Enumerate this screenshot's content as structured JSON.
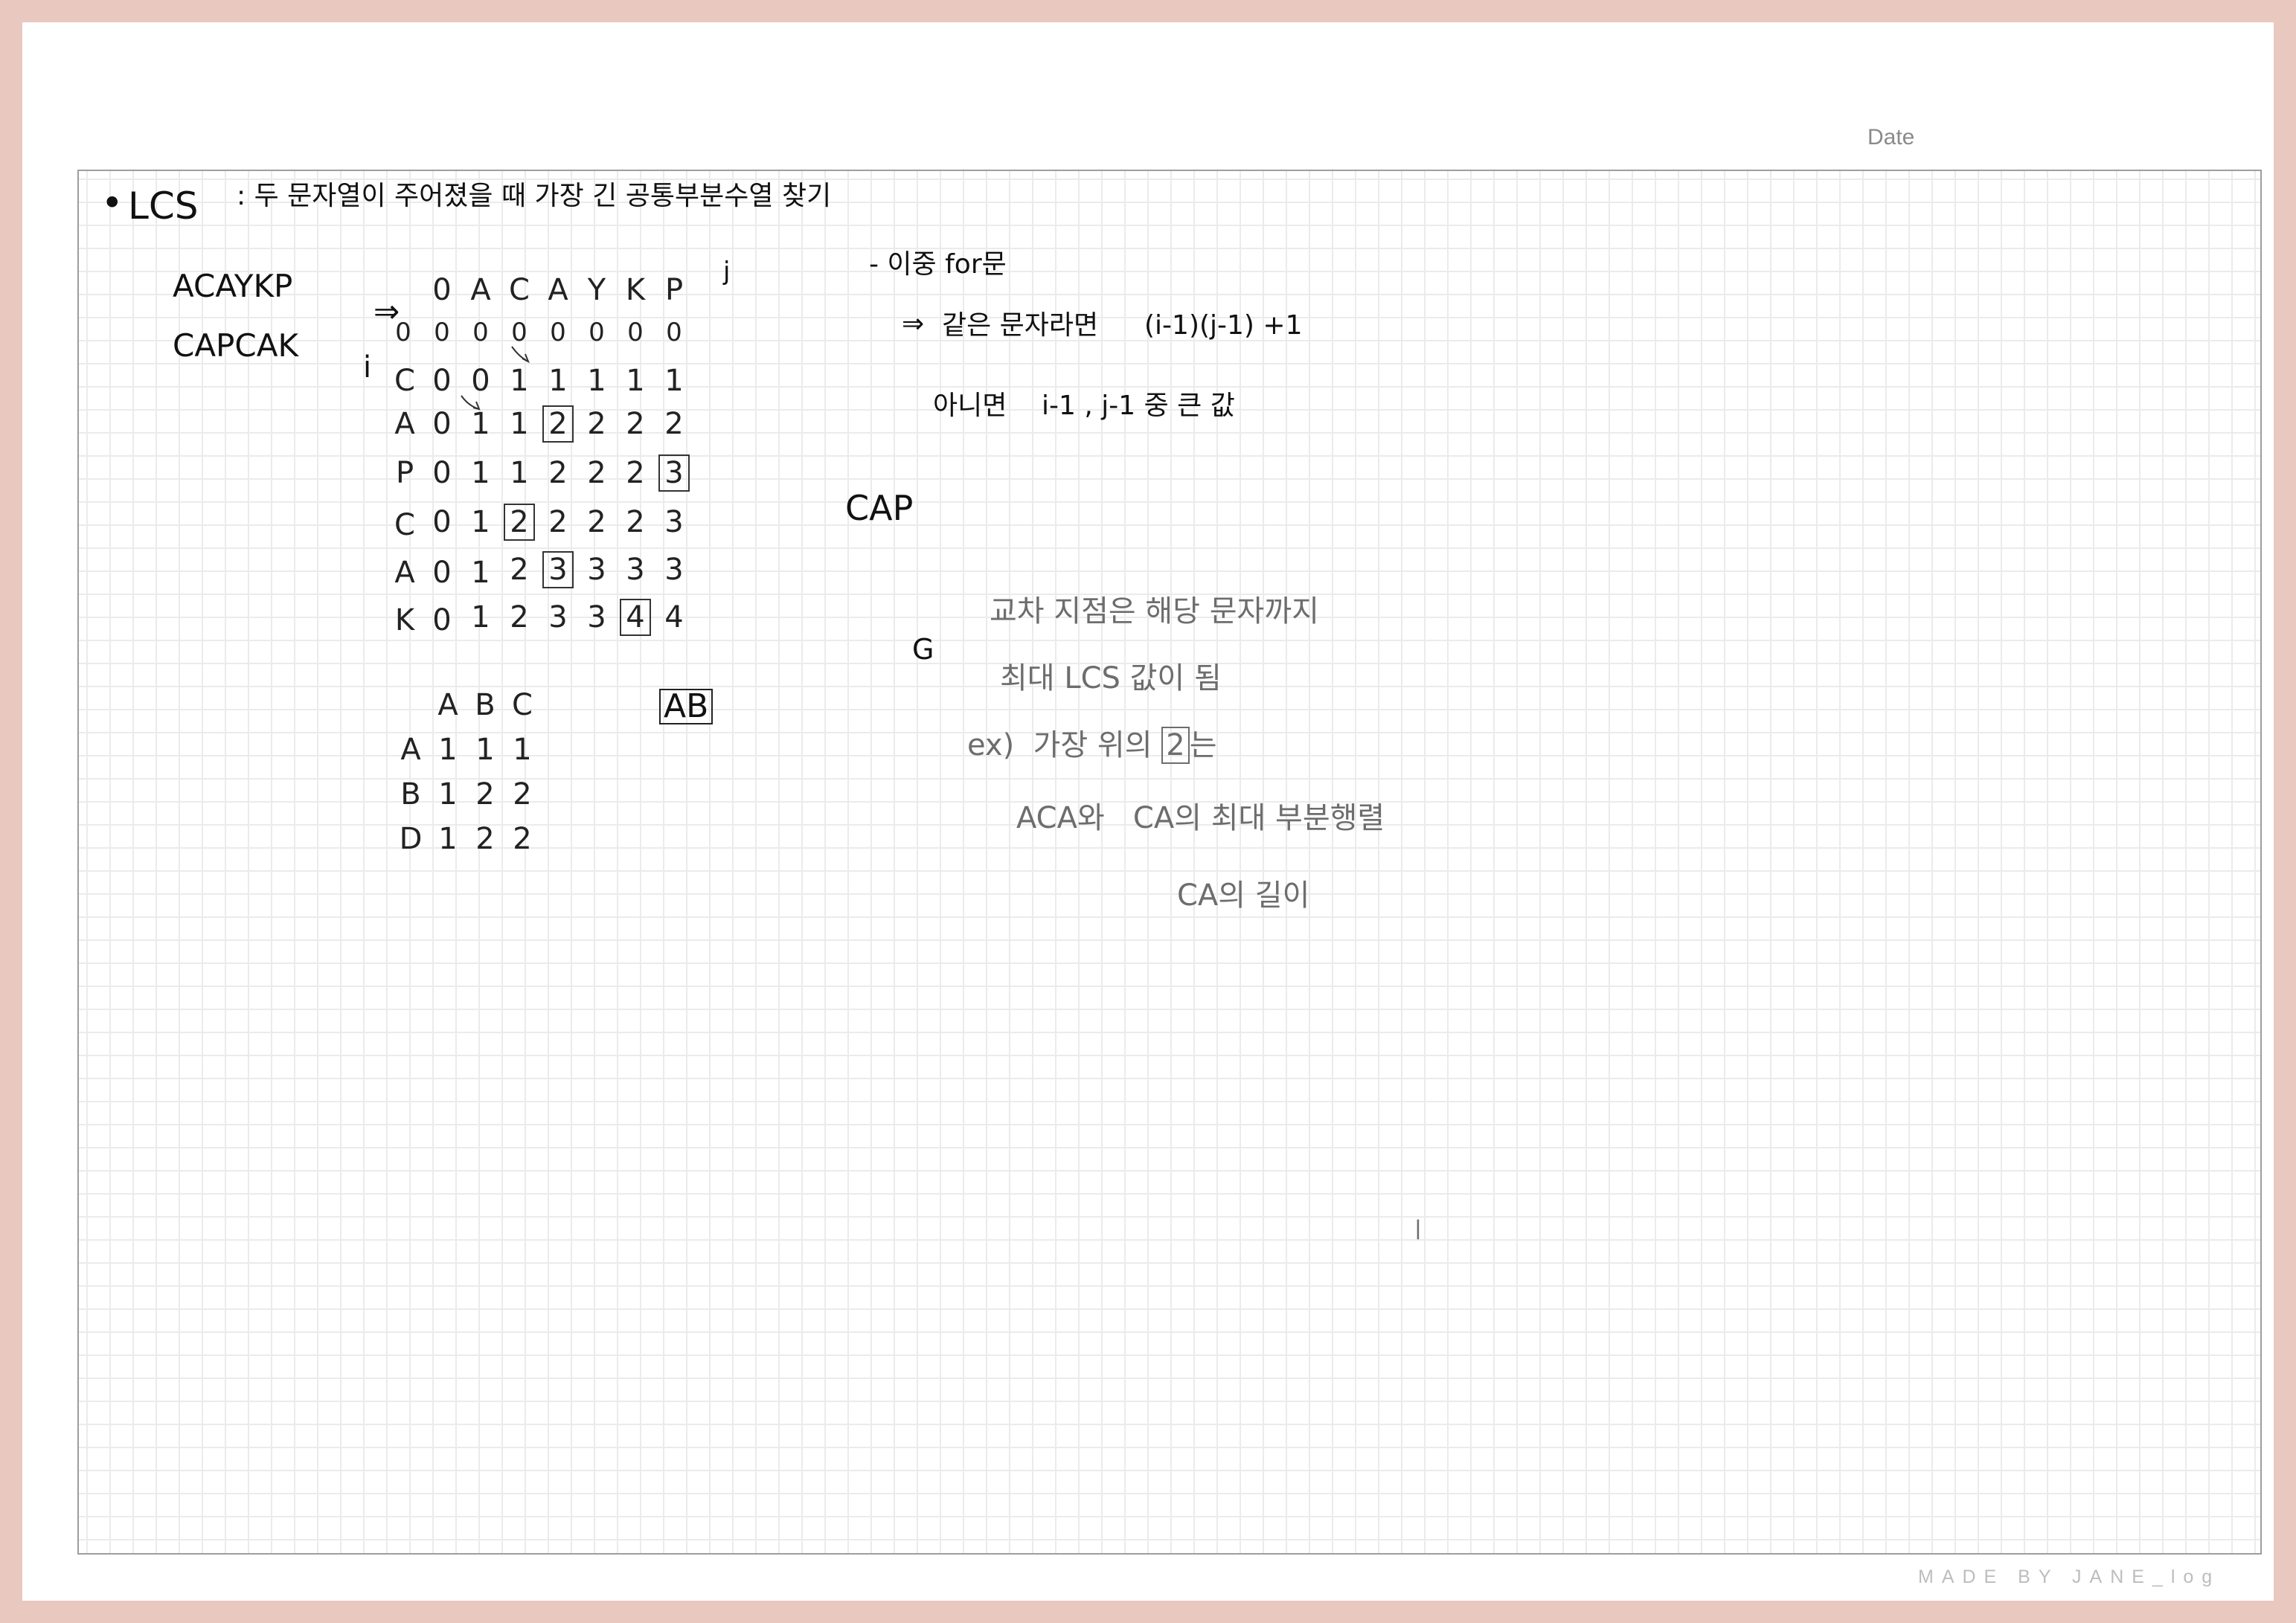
{
  "header": {
    "date_label": "Date"
  },
  "footer": {
    "credit": "MADE BY JANE_log"
  },
  "notes": {
    "title": {
      "bullet": "•",
      "topic": "LCS",
      "description": ": 두 문자열이 주어졌을 때 가장 긴 공통부분수열 찾기"
    },
    "example_strings": [
      "ACAYKP",
      "CAPCAK"
    ],
    "arrow": "⇒",
    "j_label": "j",
    "i_label": "i",
    "main_table": {
      "column_header": [
        "0",
        "A",
        "C",
        "A",
        "Y",
        "K",
        "P"
      ],
      "rows": [
        {
          "label": "",
          "cells": [
            "0",
            "0",
            "0",
            "0",
            "0",
            "0",
            "0",
            "0"
          ]
        },
        {
          "label": "C",
          "cells": [
            "0",
            "0",
            "1",
            "1",
            "1",
            "1",
            "1"
          ]
        },
        {
          "label": "A",
          "cells": [
            "0",
            "1",
            "1",
            "2",
            "2",
            "2",
            "2"
          ]
        },
        {
          "label": "P",
          "cells": [
            "0",
            "1",
            "1",
            "2",
            "2",
            "2",
            "3"
          ]
        },
        {
          "label": "C",
          "cells": [
            "0",
            "1",
            "2",
            "2",
            "2",
            "2",
            "3"
          ]
        },
        {
          "label": "A",
          "cells": [
            "0",
            "1",
            "2",
            "3",
            "3",
            "3",
            "3"
          ]
        },
        {
          "label": "K",
          "cells": [
            "0",
            "1",
            "2",
            "3",
            "3",
            "4",
            "4"
          ]
        }
      ]
    },
    "small_table": {
      "column_header": [
        "A",
        "B",
        "C"
      ],
      "rows": [
        {
          "label": "A",
          "cells": [
            "1",
            "1",
            "1"
          ]
        },
        {
          "label": "B",
          "cells": [
            "1",
            "2",
            "2"
          ]
        },
        {
          "label": "D",
          "cells": [
            "1",
            "2",
            "2"
          ]
        }
      ],
      "answer": "AB"
    },
    "algorithm": {
      "line1": "- 이중 for문",
      "line2_arrow": "⇒",
      "line2_text": "같은 문자라면",
      "line2_formula": "(i-1)(j-1) +1",
      "line3_text": "아니면",
      "line3_formula": "i-1 , j-1 중 큰 값"
    },
    "result": "CAP",
    "g_mark": "G",
    "explanation": {
      "line1": "교차 지점은 해당 문자까지",
      "line2": "최대 LCS 값이 됨",
      "line3_prefix": "ex)  가장 위의",
      "line3_boxed": "2",
      "line3_suffix": "는",
      "line4": "ACA와   CA의 최대 부분행렬",
      "line5": "CA의 길이"
    },
    "stray_mark": "ㅣ"
  }
}
